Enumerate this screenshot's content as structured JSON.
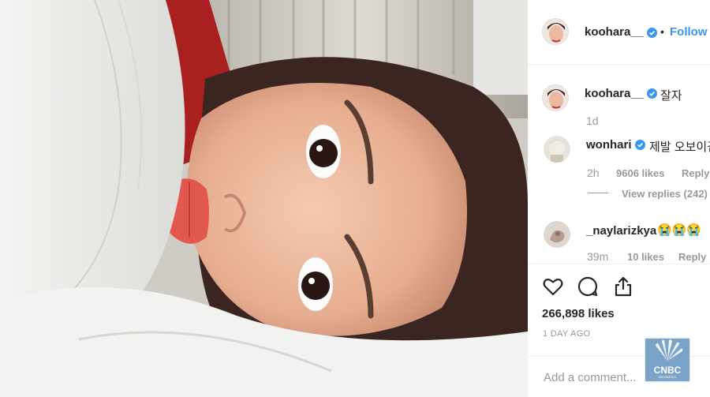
{
  "post": {
    "username": "koohara__",
    "follow_label": "Follow",
    "caption_user": "koohara__",
    "caption_text": "잘자",
    "caption_time": "1d"
  },
  "comments": [
    {
      "user": "wonhari",
      "verified": true,
      "text": "제발 오보이깁",
      "time": "2h",
      "likes": "9606 likes",
      "reply": "Reply",
      "view_replies": "View replies (242)"
    },
    {
      "user": "_naylarizkya",
      "verified": false,
      "text": "😭😭😭",
      "time": "39m",
      "likes": "10 likes",
      "reply": "Reply"
    }
  ],
  "actions": {
    "likes_count": "266,898 likes",
    "date": "1 DAY AGO",
    "comment_placeholder": "Add a comment..."
  },
  "watermark": {
    "text": "CNBC",
    "sub": "INDONESIA"
  },
  "icons": [
    "heart-icon",
    "comment-icon",
    "share-icon",
    "verified-badge-icon"
  ],
  "colors": {
    "accent": "#3897f0",
    "text": "#262626",
    "muted": "#999999",
    "verified": "#3897f0"
  }
}
